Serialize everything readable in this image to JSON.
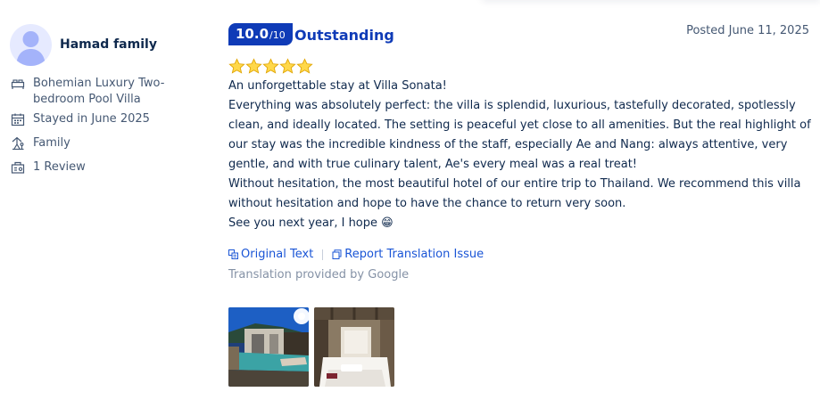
{
  "reviewer": {
    "name": "Hamad family",
    "room": "Bohemian Luxury Two-bedroom Pool Villa",
    "stay": "Stayed in June 2025",
    "trip_type": "Family",
    "reviews": "1 Review",
    "icons": [
      "bed-icon",
      "calendar-icon",
      "family-icon",
      "review-count-icon"
    ]
  },
  "review": {
    "score": "10.0",
    "score_max": "/10",
    "score_label": "Outstanding",
    "posted": "Posted June 11, 2025",
    "stars": 5,
    "lines": [
      "An unforgettable stay at Villa Sonata!",
      "Everything was absolutely perfect: the villa is splendid, luxurious, tastefully decorated, spotlessly clean, and ideally located. The setting is peaceful yet close to all amenities. But the real highlight of our stay was the incredible kindness of the staff, especially Ae and Nang: always attentive, very gentle, and with true culinary talent, Ae's every meal was a real treat!",
      "Without hesitation, the most beautiful hotel of our entire trip to Thailand. We recommend this villa without hesitation and hope to have the chance to return very soon.",
      "See you next year, I hope 😁"
    ]
  },
  "actions": {
    "original_text": "Original Text",
    "report_translation": "Report Translation Issue",
    "credit": "Translation provided by Google"
  },
  "colors": {
    "brand_blue": "#0f3bb7",
    "link_blue": "#1a55d6",
    "text_dark": "#0f294d",
    "text_muted": "#455873",
    "star_gold": "#ffb200"
  }
}
